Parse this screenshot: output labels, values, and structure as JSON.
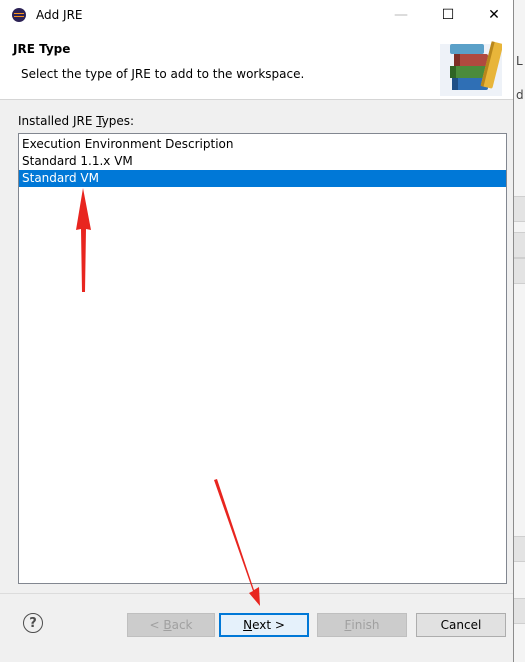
{
  "window": {
    "title": "Add JRE",
    "minimize_glyph": "—",
    "maximize_glyph": "☐",
    "close_glyph": "✕"
  },
  "header": {
    "title": "JRE Type",
    "description": "Select the type of JRE to add to the workspace."
  },
  "body": {
    "list_label_prefix": "Installed JRE ",
    "list_label_mnemonic": "T",
    "list_label_suffix": "ypes:",
    "items": [
      {
        "label": "Execution Environment Description",
        "selected": false
      },
      {
        "label": "Standard 1.1.x VM",
        "selected": false
      },
      {
        "label": "Standard VM",
        "selected": true
      }
    ]
  },
  "footer": {
    "help_glyph": "?",
    "back_prefix": "< ",
    "back_mnemonic": "B",
    "back_suffix": "ack",
    "next_mnemonic": "N",
    "next_suffix": "ext >",
    "finish_mnemonic": "F",
    "finish_suffix": "inish",
    "cancel_label": "Cancel"
  },
  "colors": {
    "selection": "#0078d7",
    "annotation_arrow": "#e8251f"
  }
}
